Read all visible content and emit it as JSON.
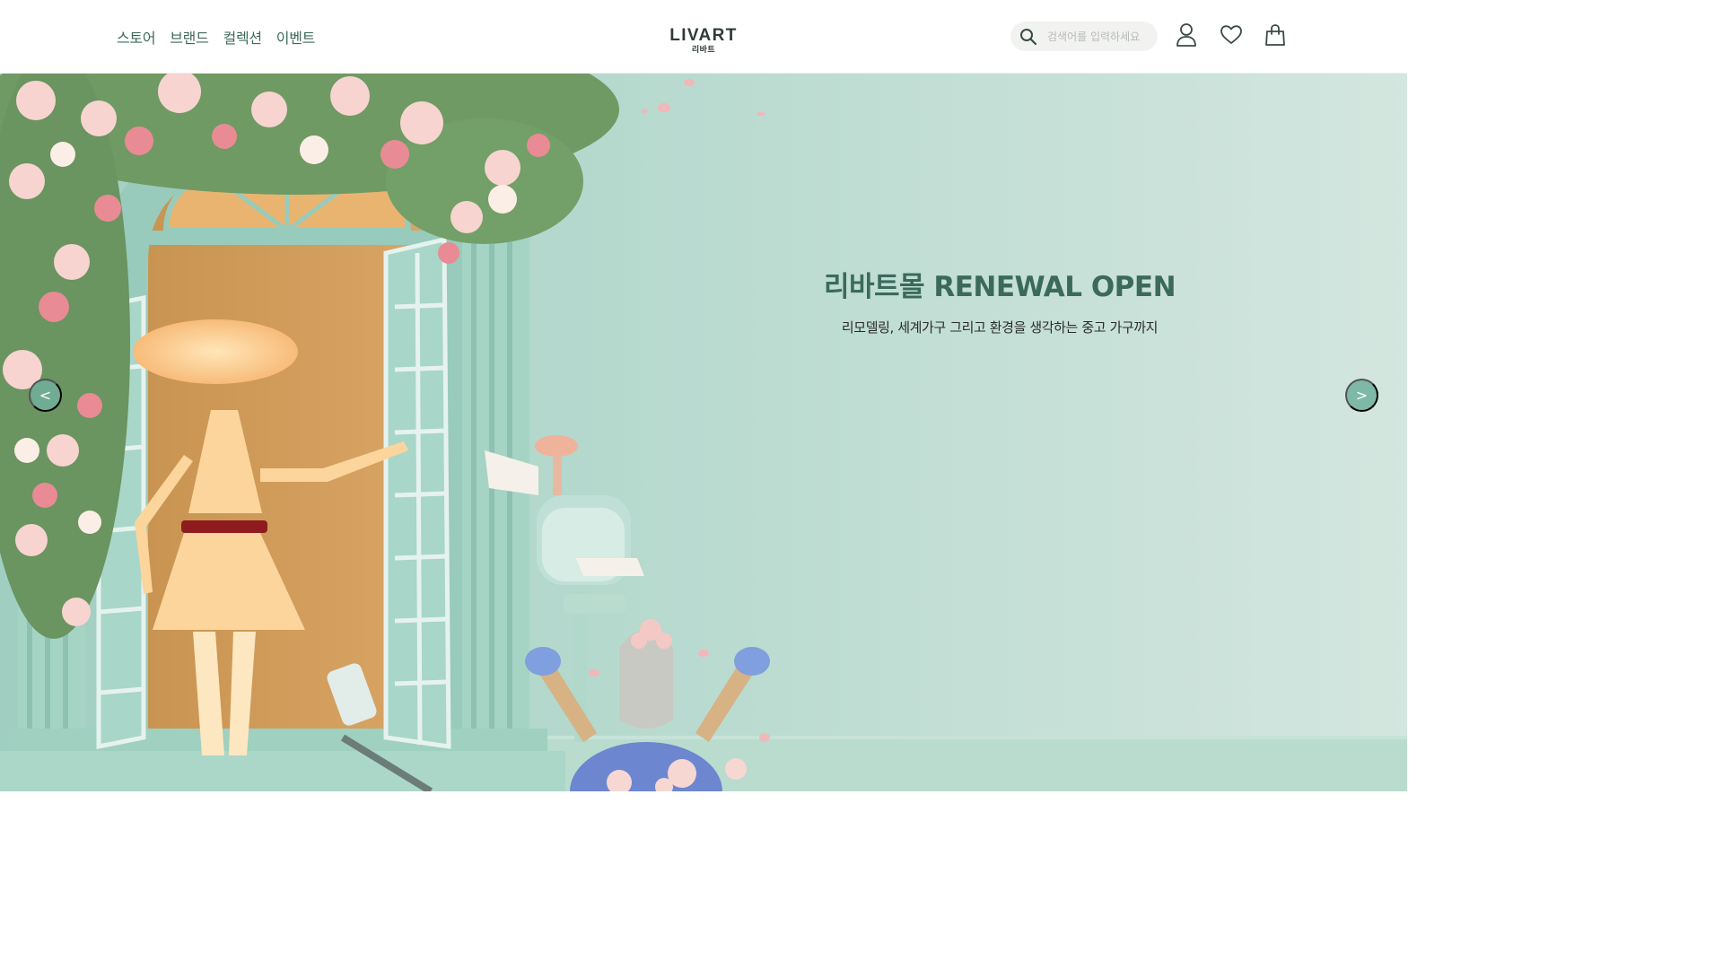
{
  "header": {
    "nav": [
      "스토어",
      "브랜드",
      "컬렉션",
      "이벤트"
    ],
    "logo": {
      "main": "LIVART",
      "sub": "리바트"
    },
    "search": {
      "placeholder": "검색어를 입력하세요"
    },
    "icons": [
      "search-icon",
      "user-icon",
      "heart-icon",
      "shopping-bag-icon"
    ]
  },
  "hero": {
    "title": "리바트몰 RENEWAL OPEN",
    "subtitle": "리모델링, 세계가구 그리고 환경을 생각하는 중고 가구까지",
    "prev_label": "<",
    "next_label": ">"
  },
  "colors": {
    "accent": "#3b6a5b",
    "nav_text": "#3e6a5e",
    "hero_bg": "#b4dbcf",
    "arrow_bg": "#70b09c"
  }
}
